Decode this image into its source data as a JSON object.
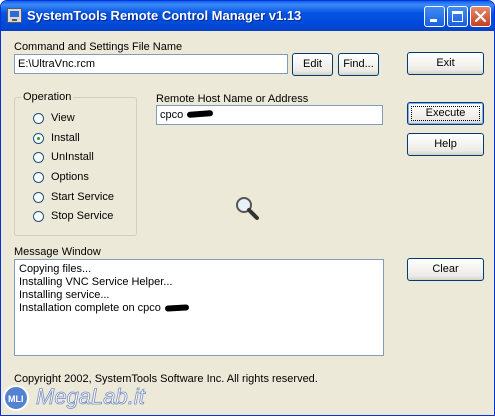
{
  "window": {
    "title": "SystemTools Remote Control Manager v1.13"
  },
  "file": {
    "label": "Command and Settings File Name",
    "value": "E:\\UltraVnc.rcm",
    "edit_label": "Edit",
    "find_label": "Find..."
  },
  "buttons": {
    "exit": "Exit",
    "execute": "Execute",
    "help": "Help",
    "clear": "Clear"
  },
  "operation": {
    "title": "Operation",
    "options": [
      "View",
      "Install",
      "UnInstall",
      "Options",
      "Start Service",
      "Stop Service"
    ],
    "selected": "Install"
  },
  "remote_host": {
    "label": "Remote Host Name or Address",
    "value": "cpco"
  },
  "message_window": {
    "label": "Message Window",
    "lines": [
      "Copying files...",
      "Installing VNC Service Helper...",
      "Installing service...",
      "Installation complete on cpco"
    ]
  },
  "footer": {
    "copyright": "Copyright 2002, SystemTools Software Inc.  All rights reserved."
  },
  "watermark": {
    "text": "MegaLab.it"
  },
  "icons": {
    "app": "app-icon",
    "minimize": "minimize-icon",
    "maximize": "maximize-icon",
    "close": "close-icon",
    "search": "magnifier-icon"
  }
}
